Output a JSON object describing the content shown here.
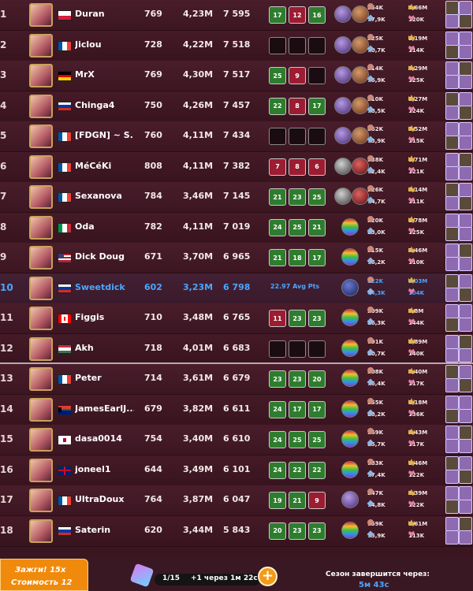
{
  "leaderboard": {
    "rows": [
      {
        "rank": "1",
        "name": "Duran",
        "flag": "PL",
        "level": "769",
        "power": "4,23M",
        "points": "7 595",
        "boxes": [
          {
            "v": "17",
            "c": "g"
          },
          {
            "v": "12",
            "c": "r"
          },
          {
            "v": "16",
            "c": "g"
          }
        ],
        "avg": "",
        "orbs": [
          "purple",
          "brown"
        ],
        "s1": "254K",
        "s2": "77,9K",
        "s3": "1,66M",
        "s4": "120K",
        "highlight": false
      },
      {
        "rank": "2",
        "name": "Jiclou",
        "flag": "FR",
        "level": "728",
        "power": "4,22M",
        "points": "7 518",
        "boxes": [
          {
            "v": "",
            "c": "e"
          },
          {
            "v": "",
            "c": "e"
          },
          {
            "v": "",
            "c": "e"
          }
        ],
        "avg": "",
        "orbs": [
          "purple",
          "brown"
        ],
        "s1": "325K",
        "s2": "70,7K",
        "s3": "1,19M",
        "s4": "114K",
        "highlight": false
      },
      {
        "rank": "3",
        "name": "MrX",
        "flag": "DE",
        "level": "769",
        "power": "4,30M",
        "points": "7 517",
        "boxes": [
          {
            "v": "25",
            "c": "g"
          },
          {
            "v": "9",
            "c": "r"
          },
          {
            "v": "",
            "c": "e"
          }
        ],
        "avg": "",
        "orbs": [
          "purple",
          "brown"
        ],
        "s1": "314K",
        "s2": "76,9K",
        "s3": "1,29M",
        "s4": "125K",
        "highlight": false
      },
      {
        "rank": "4",
        "name": "Chinga4",
        "flag": "RU",
        "level": "750",
        "power": "4,26M",
        "points": "7 457",
        "boxes": [
          {
            "v": "22",
            "c": "g"
          },
          {
            "v": "8",
            "c": "r"
          },
          {
            "v": "17",
            "c": "g"
          }
        ],
        "avg": "",
        "orbs": [
          "purple",
          "brown"
        ],
        "s1": "310K",
        "s2": "78,5K",
        "s3": "1,27M",
        "s4": "124K",
        "highlight": false
      },
      {
        "rank": "5",
        "name": "[FDGN] ~ S...",
        "flag": "FR",
        "level": "760",
        "power": "4,11M",
        "points": "7 434",
        "boxes": [
          {
            "v": "",
            "c": "e"
          },
          {
            "v": "",
            "c": "e"
          },
          {
            "v": "",
            "c": "e"
          }
        ],
        "avg": "",
        "orbs": [
          "purple",
          "brown"
        ],
        "s1": "262K",
        "s2": "73,9K",
        "s3": "1,52M",
        "s4": "115K",
        "highlight": false
      },
      {
        "rank": "6",
        "name": "MéCéKi",
        "flag": "FR",
        "level": "808",
        "power": "4,11M",
        "points": "7 382",
        "boxes": [
          {
            "v": "7",
            "c": "r"
          },
          {
            "v": "8",
            "c": "r"
          },
          {
            "v": "6",
            "c": "r"
          }
        ],
        "avg": "",
        "orbs": [
          "grey",
          "red"
        ],
        "s1": "238K",
        "s2": "72,4K",
        "s3": "1,71M",
        "s4": "121K",
        "highlight": false
      },
      {
        "rank": "7",
        "name": "Sexanova",
        "flag": "FR",
        "level": "784",
        "power": "3,46M",
        "points": "7 145",
        "boxes": [
          {
            "v": "21",
            "c": "g"
          },
          {
            "v": "23",
            "c": "g"
          },
          {
            "v": "25",
            "c": "g"
          }
        ],
        "avg": "",
        "orbs": [
          "grey",
          "red"
        ],
        "s1": "226K",
        "s2": "74,7K",
        "s3": "1,14M",
        "s4": "111K",
        "highlight": false
      },
      {
        "rank": "8",
        "name": "Oda",
        "flag": "IT",
        "level": "782",
        "power": "4,11M",
        "points": "7 019",
        "boxes": [
          {
            "v": "24",
            "c": "g"
          },
          {
            "v": "25",
            "c": "g"
          },
          {
            "v": "21",
            "c": "g"
          }
        ],
        "avg": "",
        "orbs": [
          "rainbow"
        ],
        "s1": "220K",
        "s2": "83,0K",
        "s3": "1,78M",
        "s4": "125K",
        "highlight": false
      },
      {
        "rank": "9",
        "name": "Dick Doug",
        "flag": "US",
        "level": "671",
        "power": "3,70M",
        "points": "6 965",
        "boxes": [
          {
            "v": "21",
            "c": "g"
          },
          {
            "v": "18",
            "c": "g"
          },
          {
            "v": "17",
            "c": "g"
          }
        ],
        "avg": "",
        "orbs": [
          "rainbow"
        ],
        "s1": "215K",
        "s2": "76,2K",
        "s3": "1,46M",
        "s4": "110K",
        "highlight": false
      },
      {
        "rank": "10",
        "name": "Sweetdick",
        "flag": "RU",
        "level": "602",
        "power": "3,23M",
        "points": "6 798",
        "boxes": [],
        "avg": "22.97 Avg Pts",
        "orbs": [
          "navy"
        ],
        "s1": "222K",
        "s2": "64,3K",
        "s3": "1,03M",
        "s4": "104K",
        "highlight": true
      },
      {
        "rank": "11",
        "name": "Figgis",
        "flag": "CA",
        "level": "710",
        "power": "3,48M",
        "points": "6 765",
        "boxes": [
          {
            "v": "11",
            "c": "r"
          },
          {
            "v": "23",
            "c": "g"
          },
          {
            "v": "23",
            "c": "g"
          }
        ],
        "avg": "",
        "orbs": [
          "rainbow"
        ],
        "s1": "209K",
        "s2": "86,3K",
        "s3": "1,8M",
        "s4": "144K",
        "highlight": false
      },
      {
        "rank": "12",
        "name": "Akh",
        "flag": "HU",
        "level": "718",
        "power": "4,01M",
        "points": "6 683",
        "boxes": [
          {
            "v": "",
            "c": "e"
          },
          {
            "v": "",
            "c": "e"
          },
          {
            "v": "",
            "c": "e"
          }
        ],
        "avg": "",
        "orbs": [
          "rainbow"
        ],
        "s1": "191K",
        "s2": "80,7K",
        "s3": "1,89M",
        "s4": "140K",
        "highlight": false
      },
      {
        "rank": "13",
        "name": "Peter",
        "flag": "FR",
        "level": "714",
        "power": "3,61M",
        "points": "6 679",
        "boxes": [
          {
            "v": "23",
            "c": "g"
          },
          {
            "v": "23",
            "c": "g"
          },
          {
            "v": "20",
            "c": "g"
          }
        ],
        "avg": "",
        "orbs": [
          "rainbow"
        ],
        "s1": "208K",
        "s2": "76,4K",
        "s3": "1,40M",
        "s4": "117K",
        "highlight": false
      },
      {
        "rank": "14",
        "name": "JamesEarlJ...",
        "flag": "ZA",
        "level": "679",
        "power": "3,82M",
        "points": "6 611",
        "boxes": [
          {
            "v": "24",
            "c": "g"
          },
          {
            "v": "17",
            "c": "g"
          },
          {
            "v": "17",
            "c": "g"
          }
        ],
        "avg": "",
        "orbs": [
          "rainbow"
        ],
        "s1": "255K",
        "s2": "88,2K",
        "s3": "1,18M",
        "s4": "136K",
        "highlight": false
      },
      {
        "rank": "15",
        "name": "dasa0014",
        "flag": "JP",
        "level": "754",
        "power": "3,40M",
        "points": "6 610",
        "boxes": [
          {
            "v": "24",
            "c": "g"
          },
          {
            "v": "25",
            "c": "g"
          },
          {
            "v": "25",
            "c": "g"
          }
        ],
        "avg": "",
        "orbs": [
          "rainbow"
        ],
        "s1": "169K",
        "s2": "85,7K",
        "s3": "1,43M",
        "s4": "117K",
        "highlight": false
      },
      {
        "rank": "16",
        "name": "joneel1",
        "flag": "GB",
        "level": "644",
        "power": "3,49M",
        "points": "6 101",
        "boxes": [
          {
            "v": "24",
            "c": "g"
          },
          {
            "v": "22",
            "c": "g"
          },
          {
            "v": "22",
            "c": "g"
          }
        ],
        "avg": "",
        "orbs": [
          "rainbow"
        ],
        "s1": "183K",
        "s2": "77,4K",
        "s3": "1,46M",
        "s4": "122K",
        "highlight": false
      },
      {
        "rank": "17",
        "name": "UltraDoux",
        "flag": "FR",
        "level": "764",
        "power": "3,87M",
        "points": "6 047",
        "boxes": [
          {
            "v": "19",
            "c": "g"
          },
          {
            "v": "21",
            "c": "g"
          },
          {
            "v": "9",
            "c": "r"
          }
        ],
        "avg": "",
        "orbs": [
          "purple"
        ],
        "s1": "247K",
        "s2": "74,8K",
        "s3": "1,39M",
        "s4": "122K",
        "highlight": false
      },
      {
        "rank": "18",
        "name": "Saterin",
        "flag": "RU",
        "level": "620",
        "power": "3,44M",
        "points": "5 843",
        "boxes": [
          {
            "v": "20",
            "c": "g"
          },
          {
            "v": "23",
            "c": "g"
          },
          {
            "v": "23",
            "c": "g"
          }
        ],
        "avg": "",
        "orbs": [
          "rainbow"
        ],
        "s1": "159K",
        "s2": "75,9K",
        "s3": "1,61M",
        "s4": "113K",
        "highlight": false
      }
    ]
  },
  "bottom_bar": {
    "promo_line1": "Зажги! 15x",
    "promo_line2": "Стоимость 12",
    "gem_counter": "1/15",
    "gem_timer": "+1 через 1м 22с",
    "season_label": "Сезон завершится через:",
    "season_time": "5м 43с"
  },
  "colors": {
    "highlight": "#4aa6ff",
    "win": "#2e7d2e",
    "loss": "#9c1c32",
    "accent": "#f08a0c"
  }
}
